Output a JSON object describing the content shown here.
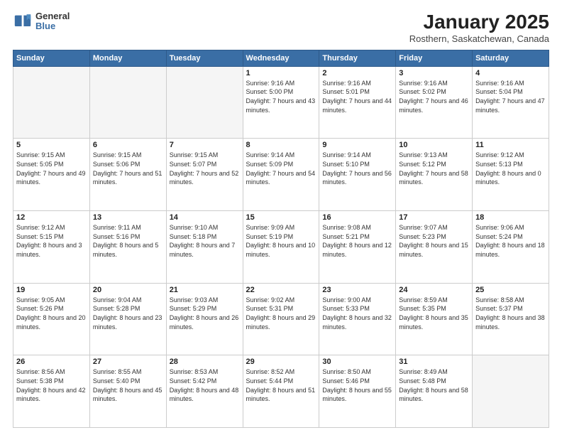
{
  "logo": {
    "general": "General",
    "blue": "Blue"
  },
  "header": {
    "month": "January 2025",
    "location": "Rosthern, Saskatchewan, Canada"
  },
  "weekdays": [
    "Sunday",
    "Monday",
    "Tuesday",
    "Wednesday",
    "Thursday",
    "Friday",
    "Saturday"
  ],
  "weeks": [
    [
      {
        "day": "",
        "info": ""
      },
      {
        "day": "",
        "info": ""
      },
      {
        "day": "",
        "info": ""
      },
      {
        "day": "1",
        "info": "Sunrise: 9:16 AM\nSunset: 5:00 PM\nDaylight: 7 hours and 43 minutes."
      },
      {
        "day": "2",
        "info": "Sunrise: 9:16 AM\nSunset: 5:01 PM\nDaylight: 7 hours and 44 minutes."
      },
      {
        "day": "3",
        "info": "Sunrise: 9:16 AM\nSunset: 5:02 PM\nDaylight: 7 hours and 46 minutes."
      },
      {
        "day": "4",
        "info": "Sunrise: 9:16 AM\nSunset: 5:04 PM\nDaylight: 7 hours and 47 minutes."
      }
    ],
    [
      {
        "day": "5",
        "info": "Sunrise: 9:15 AM\nSunset: 5:05 PM\nDaylight: 7 hours and 49 minutes."
      },
      {
        "day": "6",
        "info": "Sunrise: 9:15 AM\nSunset: 5:06 PM\nDaylight: 7 hours and 51 minutes."
      },
      {
        "day": "7",
        "info": "Sunrise: 9:15 AM\nSunset: 5:07 PM\nDaylight: 7 hours and 52 minutes."
      },
      {
        "day": "8",
        "info": "Sunrise: 9:14 AM\nSunset: 5:09 PM\nDaylight: 7 hours and 54 minutes."
      },
      {
        "day": "9",
        "info": "Sunrise: 9:14 AM\nSunset: 5:10 PM\nDaylight: 7 hours and 56 minutes."
      },
      {
        "day": "10",
        "info": "Sunrise: 9:13 AM\nSunset: 5:12 PM\nDaylight: 7 hours and 58 minutes."
      },
      {
        "day": "11",
        "info": "Sunrise: 9:12 AM\nSunset: 5:13 PM\nDaylight: 8 hours and 0 minutes."
      }
    ],
    [
      {
        "day": "12",
        "info": "Sunrise: 9:12 AM\nSunset: 5:15 PM\nDaylight: 8 hours and 3 minutes."
      },
      {
        "day": "13",
        "info": "Sunrise: 9:11 AM\nSunset: 5:16 PM\nDaylight: 8 hours and 5 minutes."
      },
      {
        "day": "14",
        "info": "Sunrise: 9:10 AM\nSunset: 5:18 PM\nDaylight: 8 hours and 7 minutes."
      },
      {
        "day": "15",
        "info": "Sunrise: 9:09 AM\nSunset: 5:19 PM\nDaylight: 8 hours and 10 minutes."
      },
      {
        "day": "16",
        "info": "Sunrise: 9:08 AM\nSunset: 5:21 PM\nDaylight: 8 hours and 12 minutes."
      },
      {
        "day": "17",
        "info": "Sunrise: 9:07 AM\nSunset: 5:23 PM\nDaylight: 8 hours and 15 minutes."
      },
      {
        "day": "18",
        "info": "Sunrise: 9:06 AM\nSunset: 5:24 PM\nDaylight: 8 hours and 18 minutes."
      }
    ],
    [
      {
        "day": "19",
        "info": "Sunrise: 9:05 AM\nSunset: 5:26 PM\nDaylight: 8 hours and 20 minutes."
      },
      {
        "day": "20",
        "info": "Sunrise: 9:04 AM\nSunset: 5:28 PM\nDaylight: 8 hours and 23 minutes."
      },
      {
        "day": "21",
        "info": "Sunrise: 9:03 AM\nSunset: 5:29 PM\nDaylight: 8 hours and 26 minutes."
      },
      {
        "day": "22",
        "info": "Sunrise: 9:02 AM\nSunset: 5:31 PM\nDaylight: 8 hours and 29 minutes."
      },
      {
        "day": "23",
        "info": "Sunrise: 9:00 AM\nSunset: 5:33 PM\nDaylight: 8 hours and 32 minutes."
      },
      {
        "day": "24",
        "info": "Sunrise: 8:59 AM\nSunset: 5:35 PM\nDaylight: 8 hours and 35 minutes."
      },
      {
        "day": "25",
        "info": "Sunrise: 8:58 AM\nSunset: 5:37 PM\nDaylight: 8 hours and 38 minutes."
      }
    ],
    [
      {
        "day": "26",
        "info": "Sunrise: 8:56 AM\nSunset: 5:38 PM\nDaylight: 8 hours and 42 minutes."
      },
      {
        "day": "27",
        "info": "Sunrise: 8:55 AM\nSunset: 5:40 PM\nDaylight: 8 hours and 45 minutes."
      },
      {
        "day": "28",
        "info": "Sunrise: 8:53 AM\nSunset: 5:42 PM\nDaylight: 8 hours and 48 minutes."
      },
      {
        "day": "29",
        "info": "Sunrise: 8:52 AM\nSunset: 5:44 PM\nDaylight: 8 hours and 51 minutes."
      },
      {
        "day": "30",
        "info": "Sunrise: 8:50 AM\nSunset: 5:46 PM\nDaylight: 8 hours and 55 minutes."
      },
      {
        "day": "31",
        "info": "Sunrise: 8:49 AM\nSunset: 5:48 PM\nDaylight: 8 hours and 58 minutes."
      },
      {
        "day": "",
        "info": ""
      }
    ]
  ]
}
